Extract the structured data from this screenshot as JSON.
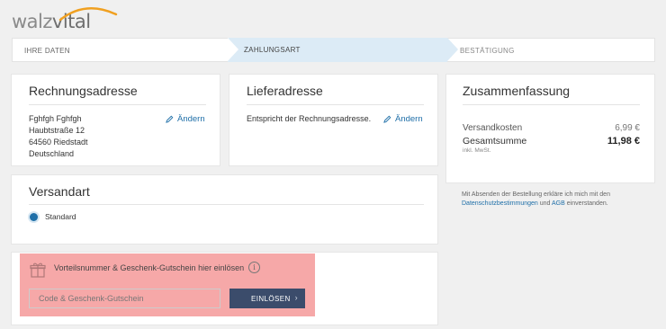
{
  "brand": {
    "logo_text_a": "walz",
    "logo_text_b": "vital"
  },
  "steps": [
    {
      "label": "IHRE DATEN"
    },
    {
      "label": "ZAHLUNGSART"
    },
    {
      "label": "BESTÄTIGUNG"
    }
  ],
  "billing": {
    "title": "Rechnungsadresse",
    "lines": [
      "Fghfgh Fghfgh",
      "Haubtstraße 12",
      "64560 Riedstadt",
      "Deutschland"
    ],
    "edit_label": "Ändern"
  },
  "shipping": {
    "title": "Lieferadresse",
    "text": "Entspricht der Rechnungsadresse.",
    "edit_label": "Ändern"
  },
  "shipping_method": {
    "title": "Versandart",
    "option_label": "Standard"
  },
  "summary": {
    "title": "Zusammenfassung",
    "shipping_cost_label": "Versandkosten",
    "shipping_cost_value": "6,99 €",
    "total_label": "Gesamtsumme",
    "total_value": "11,98 €",
    "vat_note": "inkl. MwSt."
  },
  "legal": {
    "text_before": "Mit Absenden der Bestellung erkläre ich mich mit den",
    "privacy_link": "Datenschutzbestimmungen",
    "text_and": " und ",
    "agb_link": "AGB",
    "text_after": " einverstanden."
  },
  "voucher": {
    "title": "Vorteilsnummer & Geschenk-Gutschein hier einlösen",
    "input_placeholder": "Code & Geschenk-Gutschein",
    "button_label": "EINLÖSEN",
    "info_icon": "i"
  },
  "colors": {
    "accent": "#1f6fa8",
    "active_step": "#dcebf6",
    "button": "#3b4c6b",
    "highlight": "#f6a8a8"
  }
}
